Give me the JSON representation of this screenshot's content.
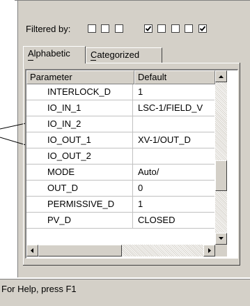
{
  "filter": {
    "label": "Filtered by:",
    "checkboxes": [
      {
        "checked": false
      },
      {
        "checked": false
      },
      {
        "checked": false
      },
      {
        "checked": true
      },
      {
        "checked": false
      },
      {
        "checked": false
      },
      {
        "checked": false
      },
      {
        "checked": true
      }
    ]
  },
  "tabs": {
    "alphabetic": {
      "label": "Alphabetic",
      "selected": true
    },
    "categorized": {
      "label": "Categorized",
      "selected": false
    }
  },
  "grid": {
    "columns": [
      "Parameter",
      "Default"
    ],
    "rows": [
      {
        "parameter": "INTERLOCK_D",
        "default": "1"
      },
      {
        "parameter": "IO_IN_1",
        "default": "LSC-1/FIELD_V"
      },
      {
        "parameter": "IO_IN_2",
        "default": ""
      },
      {
        "parameter": "IO_OUT_1",
        "default": "XV-1/OUT_D"
      },
      {
        "parameter": "IO_OUT_2",
        "default": ""
      },
      {
        "parameter": "MODE",
        "default": "Auto/"
      },
      {
        "parameter": "OUT_D",
        "default": "0"
      },
      {
        "parameter": "PERMISSIVE_D",
        "default": "1"
      },
      {
        "parameter": "PV_D",
        "default": "CLOSED"
      }
    ]
  },
  "status_bar": {
    "text": "For Help, press F1"
  },
  "colors": {
    "face": "#d4d0c8",
    "shadow": "#808080",
    "highlight": "#ffffff"
  }
}
